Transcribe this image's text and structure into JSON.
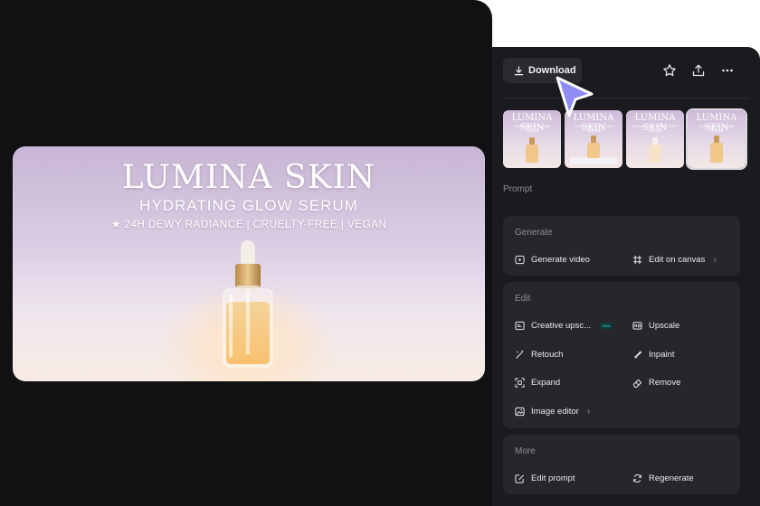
{
  "hero": {
    "brand": "LUMINA SKIN",
    "subtitle": "HYDRATING GLOW SERUM",
    "tagline": "★ 24H DEWY RADIANCE | CRUELTY-FREE | VEGAN"
  },
  "toolbar": {
    "download_label": "Download",
    "icons": [
      "star-icon",
      "share-icon",
      "more-icon"
    ]
  },
  "thumbnails": [
    {
      "title": "LUMINA SKIN",
      "subtitle": "HYDRATING GLOW SERUM",
      "selected": false
    },
    {
      "title": "LUMINA SKIN",
      "subtitle": "HYALURONIC GLOW SERUM",
      "selected": false
    },
    {
      "title": "LUMINA SKIN",
      "subtitle": "HYDRATING RECOVERY SERUM",
      "selected": false
    },
    {
      "title": "LUMINA SKIN",
      "subtitle": "HYDRATING GLOW SERUM",
      "selected": true
    }
  ],
  "prompt_label": "Prompt",
  "generate": {
    "title": "Generate",
    "generate_video": "Generate video",
    "edit_on_canvas": "Edit on canvas"
  },
  "edit": {
    "title": "Edit",
    "creative_upscale": "Creative upsc...",
    "new_badge": "New",
    "upscale": "Upscale",
    "retouch": "Retouch",
    "inpaint": "Inpaint",
    "expand": "Expand",
    "remove": "Remove",
    "image_editor": "Image editor"
  },
  "more": {
    "title": "More",
    "edit_prompt": "Edit prompt",
    "regenerate": "Regenerate"
  },
  "colors": {
    "panel_bg": "#1b1b1f",
    "section_bg": "#26262b",
    "cursor": "#8f8cf5",
    "new_badge": "#43d6c2"
  }
}
